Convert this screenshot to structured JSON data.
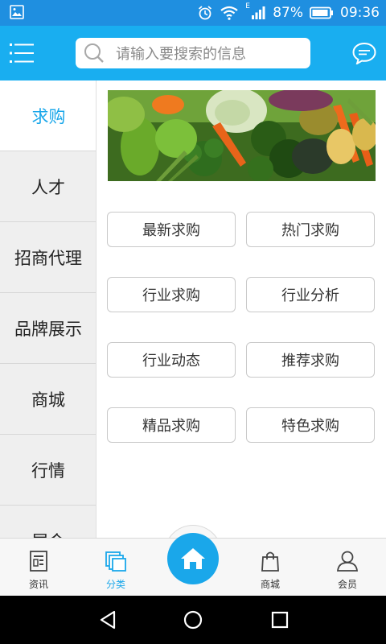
{
  "status_bar": {
    "battery": "87%",
    "time": "09:36",
    "network_label": "E"
  },
  "header": {
    "search_placeholder": "请输入要搜索的信息"
  },
  "categories": [
    {
      "label": "求购",
      "active": true
    },
    {
      "label": "人才"
    },
    {
      "label": "招商代理"
    },
    {
      "label": "品牌展示"
    },
    {
      "label": "商城"
    },
    {
      "label": "行情"
    },
    {
      "label": "展会"
    }
  ],
  "subcategories": [
    "最新求购",
    "热门求购",
    "行业求购",
    "行业分析",
    "行业动态",
    "推荐求购",
    "精品求购",
    "特色求购"
  ],
  "tabbar": {
    "tabs": [
      {
        "label": "资讯",
        "icon": "news-icon"
      },
      {
        "label": "分类",
        "icon": "category-icon",
        "active": true
      },
      {
        "label": "",
        "icon": "home-icon"
      },
      {
        "label": "商城",
        "icon": "shopping-bag-icon"
      },
      {
        "label": "会员",
        "icon": "user-icon"
      }
    ]
  },
  "colors": {
    "status_bar": "#1f8fe0",
    "header": "#19aef0",
    "accent": "#1aa7ea",
    "menu_bg": "#efefef"
  }
}
